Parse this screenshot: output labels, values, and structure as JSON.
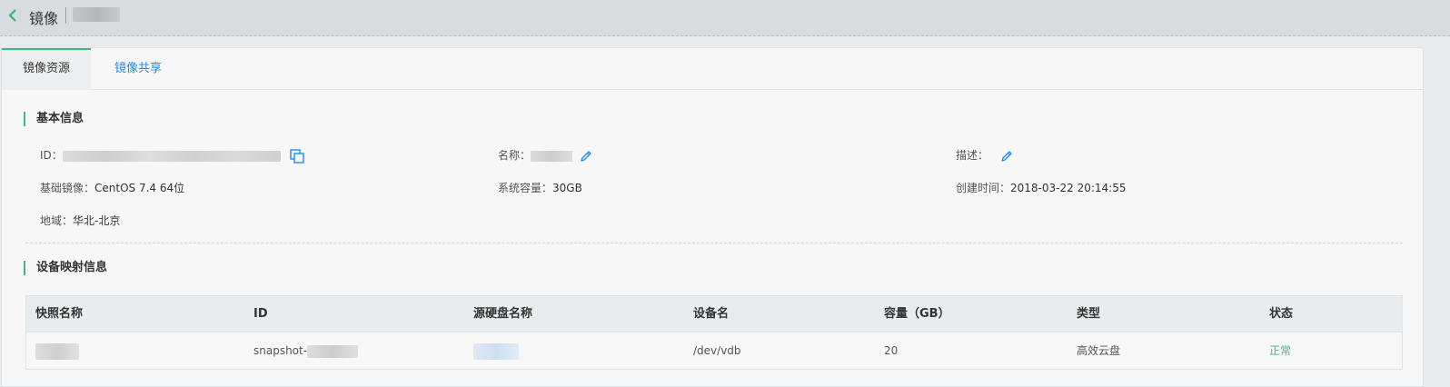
{
  "header": {
    "title": "镜像",
    "name_masked": ""
  },
  "tabs": [
    {
      "label": "镜像资源",
      "active": true
    },
    {
      "label": "镜像共享",
      "active": false
    }
  ],
  "basic_info": {
    "title": "基本信息",
    "id_label": "ID：",
    "name_label": "名称：",
    "desc_label": "描述：",
    "base_image_label": "基础镜像：",
    "base_image_value": "CentOS 7.4 64位",
    "sys_capacity_label": "系统容量：",
    "sys_capacity_value": "30GB",
    "created_label": "创建时间：",
    "created_value": "2018-03-22 20:14:55",
    "region_label": "地域：",
    "region_value": "华北-北京"
  },
  "device_mapping": {
    "title": "设备映射信息",
    "columns": [
      "快照名称",
      "ID",
      "源硬盘名称",
      "设备名",
      "容量（GB）",
      "类型",
      "状态"
    ],
    "rows": [
      {
        "snapshot_name": "",
        "id_prefix": "snapshot-",
        "source_disk": "",
        "device": "/dev/vdb",
        "capacity": "20",
        "type": "高效云盘",
        "status": "正常"
      }
    ]
  },
  "colors": {
    "accent_green": "#3dbd7d",
    "link_blue": "#1f8ceb"
  },
  "icons": {
    "back": "chevron-left-icon",
    "copy": "copy-icon",
    "edit": "pencil-icon"
  }
}
